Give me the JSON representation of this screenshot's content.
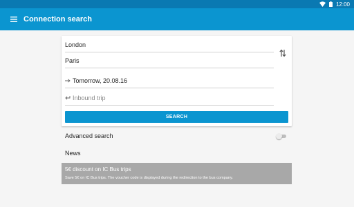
{
  "status_bar": {
    "time": "12:00",
    "icons": [
      "wifi-icon",
      "battery-icon"
    ]
  },
  "app_bar": {
    "menu_icon": "hamburger-menu-icon",
    "title": "Connection search"
  },
  "search_form": {
    "from_value": "London",
    "to_value": "Paris",
    "swap_icon": "swap-vertical-icon",
    "outbound_icon": "arrow-right-icon",
    "outbound_date": "Tomorrow, 20.08.16",
    "inbound_icon": "return-arrow-icon",
    "inbound_placeholder": "Inbound trip",
    "search_button_label": "SEARCH"
  },
  "options": {
    "advanced_search_label": "Advanced search",
    "advanced_search_enabled": false,
    "news_label": "News"
  },
  "promo": {
    "title": "5€ discount on IC Bus trips",
    "text": "Save 5€ on IC Bus trips. The voucher code is displayed during the redirection to the bus company."
  },
  "colors": {
    "status_bar": "#0a79b2",
    "app_bar": "#0b95d0",
    "accent": "#0b95d0",
    "promo_background": "#a8a8a8",
    "background": "#f5f5f5"
  }
}
